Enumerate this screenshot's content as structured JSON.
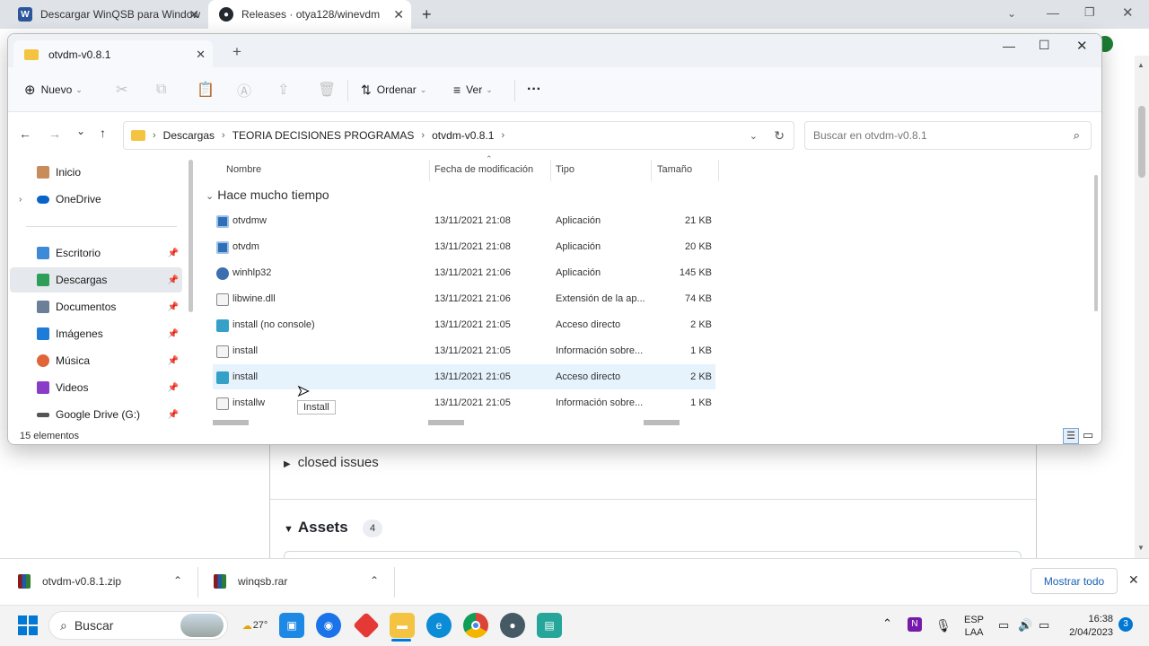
{
  "browser": {
    "tabs": [
      {
        "label": "Descargar WinQSB para Window",
        "icon": "word-icon"
      },
      {
        "label": "Releases · otya128/winevdm",
        "icon": "github-icon"
      }
    ],
    "new_tab": "+"
  },
  "page": {
    "closed_issues": "closed issues",
    "assets_title": "Assets",
    "assets_count": "4"
  },
  "explorer": {
    "tab_title": "otvdm-v0.8.1",
    "new_tab": "+",
    "toolbar": {
      "new": "Nuevo",
      "sort": "Ordenar",
      "view": "Ver",
      "more": "···"
    },
    "breadcrumb": [
      "Descargas",
      "TEORIA DECISIONES PROGRAMAS",
      "otvdm-v0.8.1"
    ],
    "search_placeholder": "Buscar en otvdm-v0.8.1",
    "nav": {
      "home": "Inicio",
      "onedrive": "OneDrive",
      "desktop": "Escritorio",
      "downloads": "Descargas",
      "documents": "Documentos",
      "images": "Imágenes",
      "music": "Música",
      "videos": "Videos",
      "gdrive": "Google Drive (G:)"
    },
    "columns": {
      "name": "Nombre",
      "modified": "Fecha de modificación",
      "type": "Tipo",
      "size": "Tamaño"
    },
    "group": "Hace mucho tiempo",
    "files": [
      {
        "name": "otvdmw",
        "date": "13/11/2021 21:08",
        "type": "Aplicación",
        "size": "21 KB"
      },
      {
        "name": "otvdm",
        "date": "13/11/2021 21:08",
        "type": "Aplicación",
        "size": "20 KB"
      },
      {
        "name": "winhlp32",
        "date": "13/11/2021 21:06",
        "type": "Aplicación",
        "size": "145 KB"
      },
      {
        "name": "libwine.dll",
        "date": "13/11/2021 21:06",
        "type": "Extensión de la ap...",
        "size": "74 KB"
      },
      {
        "name": "install (no console)",
        "date": "13/11/2021 21:05",
        "type": "Acceso directo",
        "size": "2 KB"
      },
      {
        "name": "install",
        "date": "13/11/2021 21:05",
        "type": "Información sobre...",
        "size": "1 KB"
      },
      {
        "name": "install",
        "date": "13/11/2021 21:05",
        "type": "Acceso directo",
        "size": "2 KB"
      },
      {
        "name": "installw",
        "date": "13/11/2021 21:05",
        "type": "Información sobre...",
        "size": "1 KB"
      }
    ],
    "status": "15 elementos",
    "tooltip": "Install"
  },
  "downloads": [
    {
      "name": "otvdm-v0.8.1.zip"
    },
    {
      "name": "winqsb.rar"
    }
  ],
  "show_all": "Mostrar todo",
  "taskbar": {
    "search": "Buscar",
    "weather": "27°",
    "lang1": "ESP",
    "lang2": "LAA",
    "time": "16:38",
    "date": "2/04/2023",
    "notif": "3"
  }
}
